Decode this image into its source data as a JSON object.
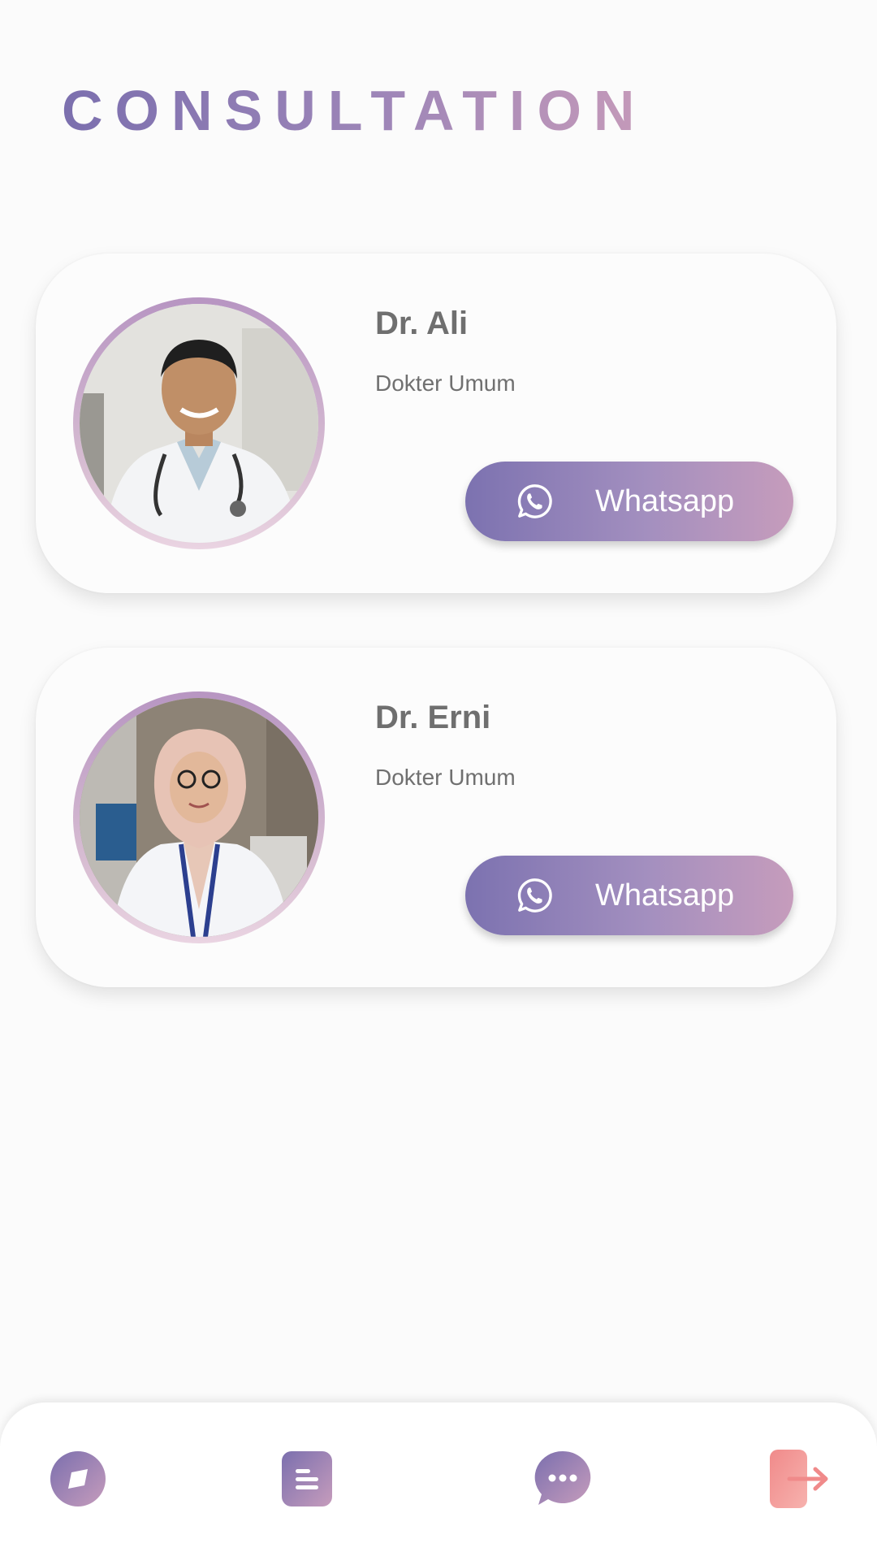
{
  "page": {
    "title": "CONSULTATION"
  },
  "doctors": [
    {
      "name": "Dr. Ali",
      "specialty": "Dokter Umum",
      "button_label": "Whatsapp",
      "button_icon": "whatsapp-icon",
      "photo": "doctor-photo-male"
    },
    {
      "name": "Dr. Erni",
      "specialty": "Dokter Umum",
      "button_label": "Whatsapp",
      "button_icon": "whatsapp-icon",
      "photo": "doctor-photo-female-hijab"
    }
  ],
  "bottom_nav": {
    "items": [
      {
        "icon": "compass-icon"
      },
      {
        "icon": "document-icon"
      },
      {
        "icon": "chat-bubble-icon"
      },
      {
        "icon": "logout-icon"
      }
    ]
  },
  "colors": {
    "gradient_start": "#7b6fae",
    "gradient_end": "#c69cbc",
    "logout_color": "#f08a8a",
    "text_gray": "#6f6f6f",
    "background": "#fbfbfb"
  }
}
